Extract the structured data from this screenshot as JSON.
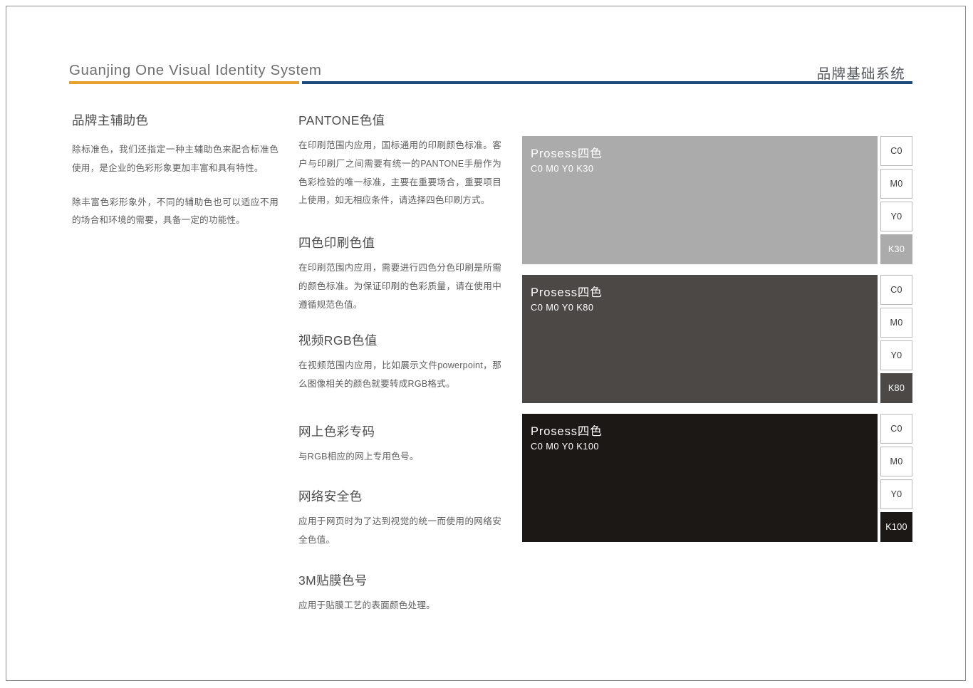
{
  "header": {
    "brand_latin": "Guanjing  One Visual Identity System",
    "section_title_cn": "品牌基础系统",
    "rule_orange_color": "#e8a12c",
    "rule_navy_color": "#1d4a7c"
  },
  "left_column": {
    "title": "品牌主辅助色",
    "paragraphs": [
      "除标准色，我们还指定一种主辅助色来配合标准色使用，是企业的色彩形象更加丰富和具有特性。",
      "除丰富色彩形象外，不同的辅助色也可以适应不用的场合和环境的需要，具备一定的功能性。"
    ]
  },
  "mid_column": {
    "sections": [
      {
        "title": "PANTONE色值",
        "body": "在印刷范围内应用，国标通用的印刷颜色标准。客户与印刷厂之间需要有统一的PANTONE手册作为色彩检验的唯一标准，主要在重要场合，重要项目上使用，如无相应条件，请选择四色印刷方式。"
      },
      {
        "title": "四色印刷色值",
        "body": "在印刷范围内应用，需要进行四色分色印刷是所需的颜色标准。为保证印刷的色彩质量，请在使用中遵循规范色值。"
      },
      {
        "title": "视频RGB色值",
        "body": "在视频范围内应用，比如展示文件powerpoint，那么图像相关的颜色就要转成RGB格式。"
      },
      {
        "title": "网上色彩专码",
        "body": "与RGB相应的网上专用色号。"
      },
      {
        "title": "网络安全色",
        "body": "应用于网页时为了达到视觉的统一而使用的网络安全色值。"
      },
      {
        "title": "3M贴膜色号",
        "body": "应用于贴膜工艺的表面颜色处理。"
      }
    ]
  },
  "swatches": [
    {
      "name": "Prosess四色",
      "code": "C0 M0 Y0 K30",
      "fill": "#ababab",
      "chips": [
        {
          "label": "C0",
          "filled": false
        },
        {
          "label": "M0",
          "filled": false
        },
        {
          "label": "Y0",
          "filled": false
        },
        {
          "label": "K30",
          "filled": true
        }
      ]
    },
    {
      "name": "Prosess四色",
      "code": "C0 M0 Y0 K80",
      "fill": "#4b4845",
      "chips": [
        {
          "label": "C0",
          "filled": false
        },
        {
          "label": "M0",
          "filled": false
        },
        {
          "label": "Y0",
          "filled": false
        },
        {
          "label": "K80",
          "filled": true
        }
      ]
    },
    {
      "name": "Prosess四色",
      "code": "C0 M0 Y0 K100",
      "fill": "#1c1815",
      "chips": [
        {
          "label": "C0",
          "filled": false
        },
        {
          "label": "M0",
          "filled": false
        },
        {
          "label": "Y0",
          "filled": false
        },
        {
          "label": "K100",
          "filled": true
        }
      ]
    }
  ]
}
